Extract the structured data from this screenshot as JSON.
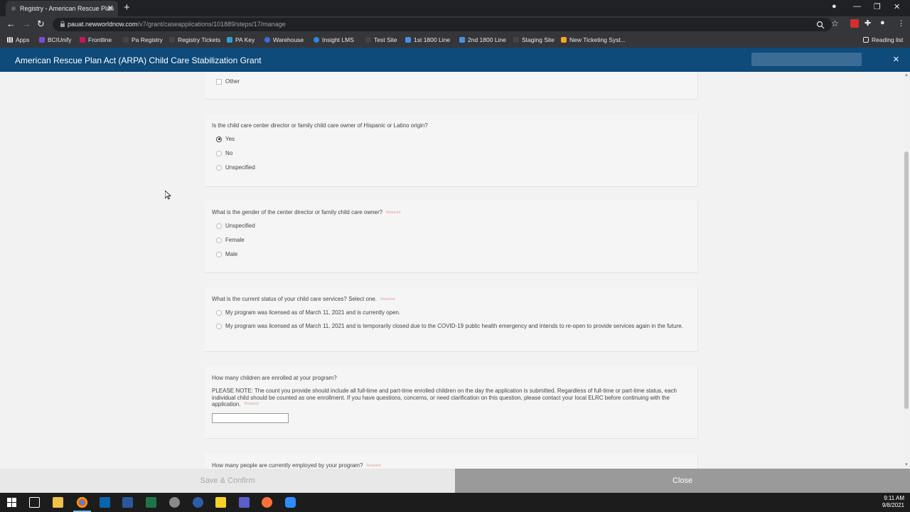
{
  "browser": {
    "tab_title": "Registry - American Rescue Plan",
    "new_tab": "+",
    "url_host": "pauat.newworldnow.com",
    "url_path": "/v7/grant/caseapplications/101889/steps/17/manage",
    "bookmarks": [
      {
        "label": "Apps",
        "color": "#e8eaed"
      },
      {
        "label": "BCIUnify",
        "color": "#7a4fd0"
      },
      {
        "label": "Frontline",
        "color": "#c2185b"
      },
      {
        "label": "Pa Registry",
        "color": "#444444"
      },
      {
        "label": "Registry Tickets",
        "color": "#444444"
      },
      {
        "label": "PA Key",
        "color": "#2e9dd8"
      },
      {
        "label": "Warehouse",
        "color": "#3a6fd8"
      },
      {
        "label": "Insight LMS",
        "color": "#2e86de"
      },
      {
        "label": "Test Site",
        "color": "#444444"
      },
      {
        "label": "1st 1800 Line",
        "color": "#4a90e2"
      },
      {
        "label": "2nd 1800 Line",
        "color": "#4a90e2"
      },
      {
        "label": "Staging Site",
        "color": "#444444"
      },
      {
        "label": "New Ticketing Syst...",
        "color": "#f5a623"
      }
    ],
    "reading_list": "Reading list"
  },
  "app": {
    "title": "American Rescue Plan Act (ARPA) Child Care Stabilization Grant",
    "close_icon": "×"
  },
  "form": {
    "prev_option": "Other",
    "q_hispanic": {
      "question": "Is the child care center director or family child care owner of Hispanic or Latino origin?",
      "options": [
        "Yes",
        "No",
        "Unspecified"
      ],
      "selected": "Yes"
    },
    "q_gender": {
      "question": "What is the gender of the center director or family child care owner?",
      "required": "Required",
      "options": [
        "Unspecified",
        "Female",
        "Male"
      ]
    },
    "q_status": {
      "question": "What is the current status of your child care services? Select one.",
      "required": "Required",
      "options": [
        "My program was licensed as of March 11, 2021 and is currently open.",
        "My program was licensed as of March 11, 2021 and is temporarily closed due to the COVID-19 public health emergency and intends to re-open to provide services again in the future."
      ]
    },
    "q_children": {
      "question": "How many children are enrolled at your program?",
      "note": "PLEASE NOTE: The count you provide should include all full-time and part-time enrolled children on the day the application is submitted. Regardless of full-time or part-time status, each individual child should be counted as one enrollment. If you have questions, concerns, or need clarification on this question, please contact your local ELRC before continuing with the application.",
      "required": "Required",
      "value": ""
    },
    "q_employees": {
      "question": "How many people are currently employed by your program?",
      "required": "Required"
    }
  },
  "footer": {
    "save_label": "Save & Confirm",
    "close_label": "Close"
  },
  "taskbar": {
    "time": "9:11 AM",
    "date": "9/8/2021"
  }
}
